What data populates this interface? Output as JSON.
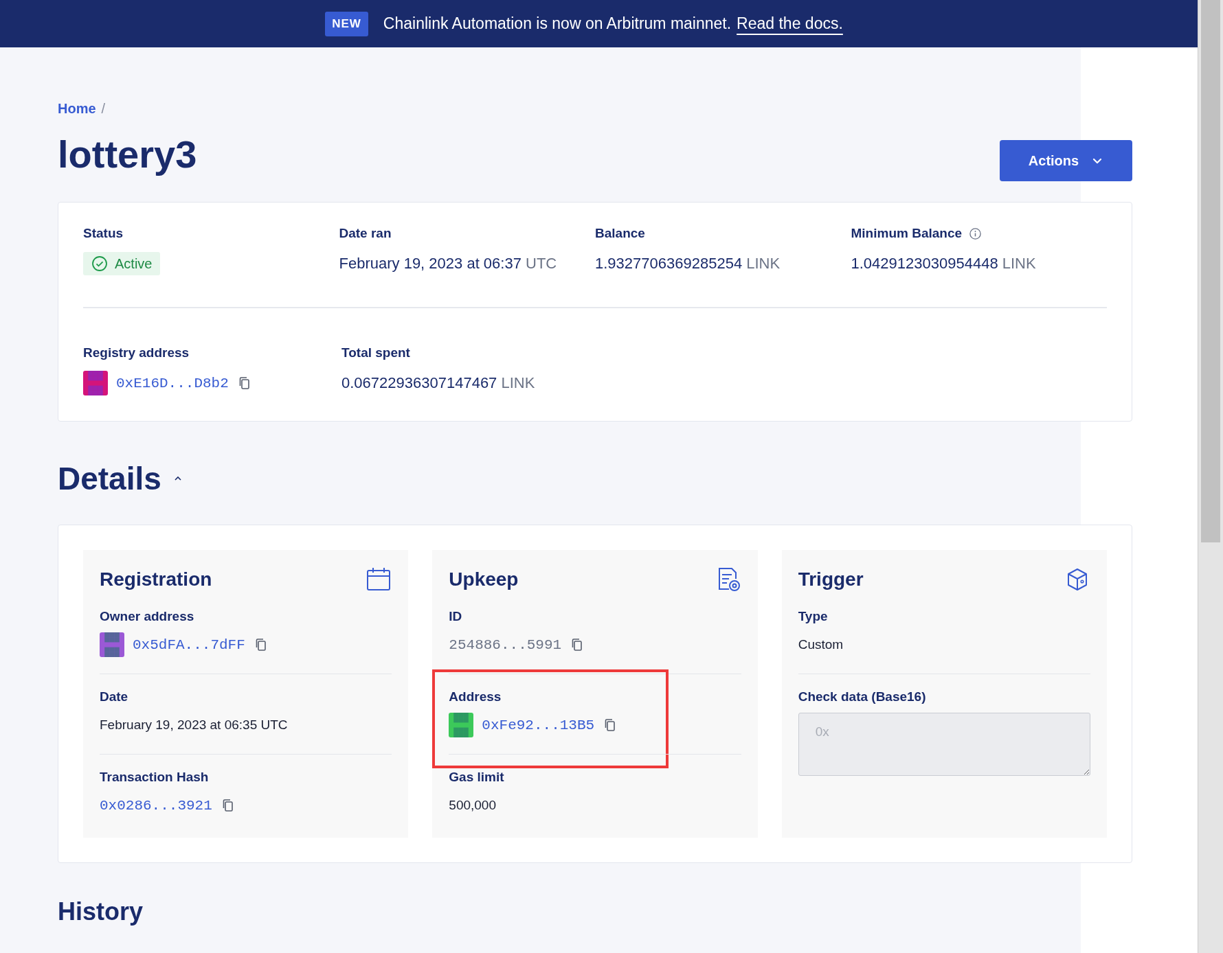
{
  "banner": {
    "badge": "NEW",
    "message": "Chainlink Automation is now on Arbitrum mainnet.",
    "link": "Read the docs."
  },
  "breadcrumb": {
    "items": [
      "Home"
    ],
    "separator": "/"
  },
  "title": "lottery3",
  "actions_button": "Actions",
  "summary": {
    "rows": [
      [
        {
          "label": "Status",
          "kind": "status",
          "value": "Active",
          "info": false
        },
        {
          "label": "Date ran",
          "kind": "text",
          "value": "February 19, 2023 at 06:37",
          "unit": "UTC",
          "info": false
        },
        {
          "label": "Balance",
          "kind": "text",
          "value": "1.9327706369285254",
          "unit": "LINK",
          "info": false
        },
        {
          "label": "Minimum Balance",
          "kind": "text",
          "value": "1.0429123030954448",
          "unit": "LINK",
          "info": true
        }
      ],
      [
        {
          "label": "Registry address",
          "kind": "address",
          "value": "0xE16D...D8b2",
          "color": "#d4147a",
          "info": false
        },
        {
          "label": "Total spent",
          "kind": "text",
          "value": "0.06722936307147467",
          "unit": "LINK",
          "info": false
        }
      ]
    ]
  },
  "details": {
    "heading": "Details",
    "expanded": true,
    "cards": [
      {
        "title": "Registration",
        "fields": [
          {
            "label": "Owner address",
            "kind": "address",
            "value": "0x5dFA...7dFF",
            "color": "#9b59d6",
            "highlighted": false
          },
          {
            "label": "Date",
            "kind": "text",
            "value": "February 19, 2023 at 06:35 UTC",
            "highlighted": false
          },
          {
            "label": "Transaction Hash",
            "kind": "link",
            "value": "0x0286...3921",
            "highlighted": false
          }
        ]
      },
      {
        "title": "Upkeep",
        "fields": [
          {
            "label": "ID",
            "kind": "mono",
            "value": "254886...5991",
            "highlighted": false
          },
          {
            "label": "Address",
            "kind": "address",
            "value": "0xFe92...13B5",
            "color": "#3cc95a",
            "highlighted": true
          },
          {
            "label": "Gas limit",
            "kind": "text",
            "value": "500,000",
            "highlighted": false
          }
        ]
      },
      {
        "title": "Trigger",
        "fields": [
          {
            "label": "Type",
            "kind": "text",
            "value": "Custom",
            "highlighted": false
          },
          {
            "label": "Check data (Base16)",
            "kind": "textarea",
            "placeholder": "0x",
            "highlighted": false
          }
        ]
      }
    ]
  },
  "history": {
    "heading": "History"
  }
}
